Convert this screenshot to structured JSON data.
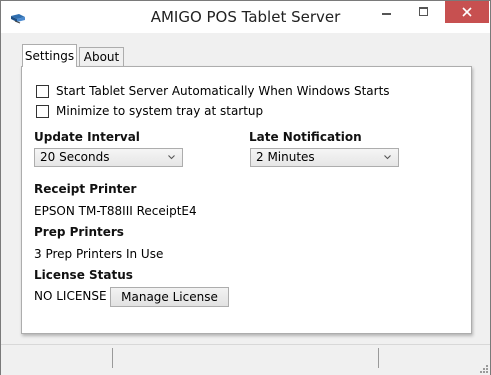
{
  "window": {
    "title": "AMIGO POS Tablet Server"
  },
  "tabs": {
    "settings": "Settings",
    "about": "About"
  },
  "settings": {
    "auto_start_label": "Start Tablet Server Automatically When Windows Starts",
    "auto_start_checked": false,
    "minimize_label": "Minimize to system tray at startup",
    "minimize_checked": false,
    "update_interval_label": "Update Interval",
    "update_interval_value": "20 Seconds",
    "late_notification_label": "Late Notification",
    "late_notification_value": "2 Minutes",
    "receipt_printer_label": "Receipt Printer",
    "receipt_printer_value": "EPSON TM-T88III ReceiptE4",
    "prep_printers_label": "Prep Printers",
    "prep_printers_value": "3 Prep Printers In Use",
    "license_status_label": "License Status",
    "license_status_value": "NO LICENSE",
    "manage_license_button": "Manage License"
  },
  "icons": {
    "app": "app-icon",
    "minimize": "minimize-icon",
    "maximize": "maximize-icon",
    "close": "close-icon",
    "dropdown": "chevron-down-icon",
    "resize_grip": "resize-grip-icon"
  },
  "colors": {
    "close_button": "#c75050",
    "window_bg": "#f0f0f0",
    "panel_bg": "#ffffff"
  }
}
